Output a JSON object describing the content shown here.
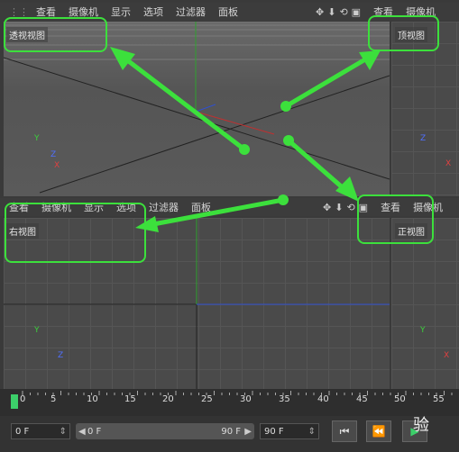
{
  "top_menu": [
    "查看",
    "摄像机",
    "显示",
    "选项",
    "过滤器",
    "面板"
  ],
  "top_right_menu": [
    "查看",
    "摄像机"
  ],
  "mid_menu": [
    "查看",
    "摄像机",
    "显示",
    "选项",
    "过滤器",
    "面板"
  ],
  "mid_right_menu": [
    "查看",
    "摄像机"
  ],
  "viewports": {
    "perspective": "透视视图",
    "top": "顶视图",
    "right": "右视图",
    "front": "正视图"
  },
  "axis": {
    "x": "X",
    "y": "Y",
    "z": "Z"
  },
  "timeline_ticks": [
    "0",
    "5",
    "10",
    "15",
    "20",
    "25",
    "30",
    "35",
    "40",
    "45",
    "50",
    "55"
  ],
  "controls": {
    "start_frame": "0 F",
    "range_start": "0 F",
    "range_end": "90 F",
    "end_frame": "90 F"
  },
  "icons": [
    "move-icon",
    "arrow-down-icon",
    "rotate-icon",
    "layout-icon",
    "play-icon",
    "rewind-icon"
  ],
  "annotation_color": "#3ce03c",
  "watermark": "验"
}
